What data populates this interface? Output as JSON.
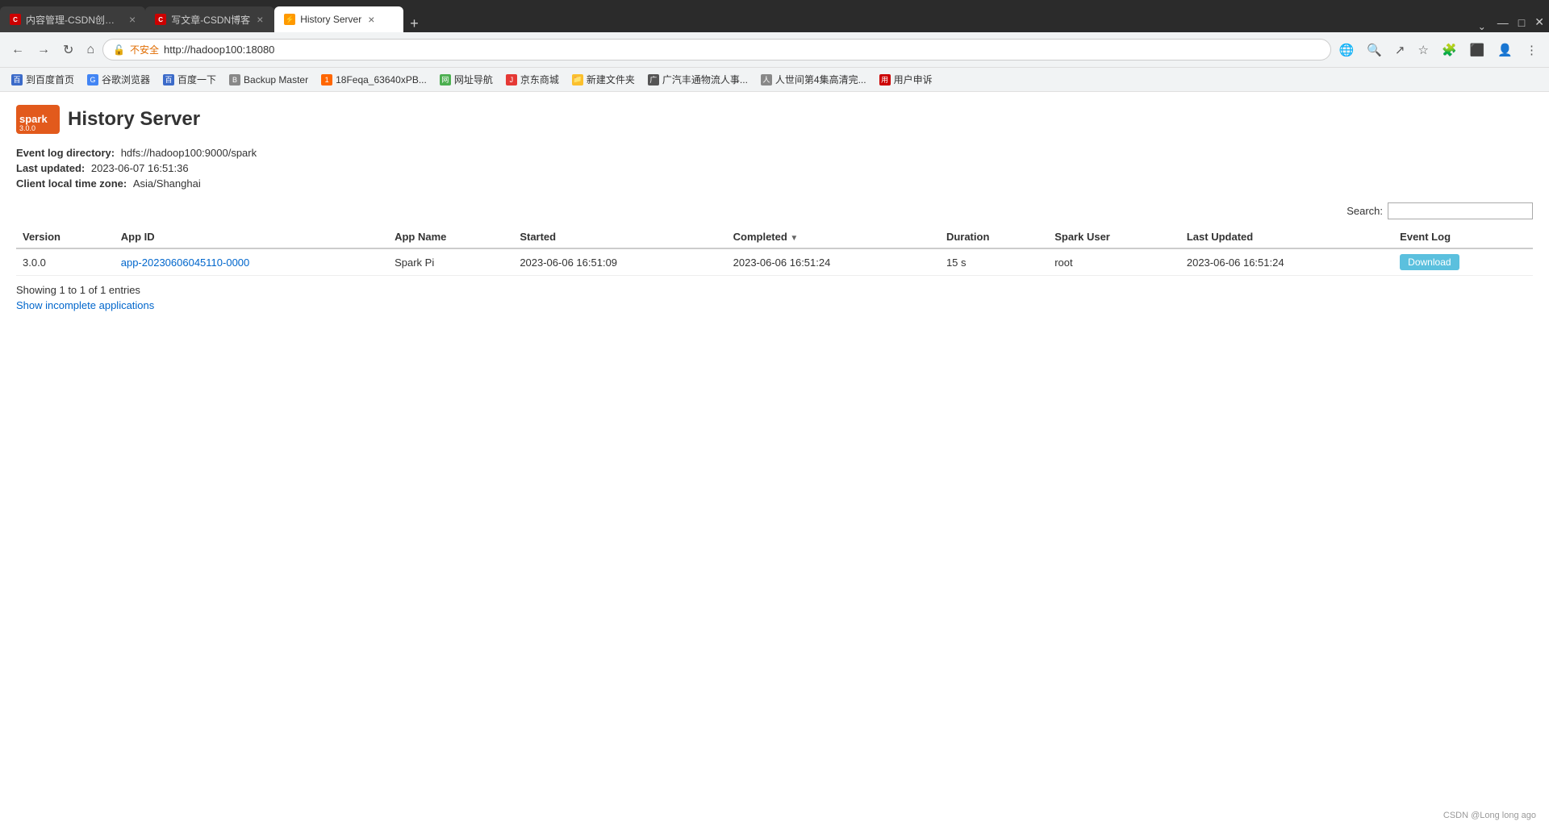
{
  "browser": {
    "tabs": [
      {
        "id": "tab1",
        "favicon_color": "#c00",
        "favicon_text": "C",
        "label": "内容管理-CSDN创作中心",
        "active": false
      },
      {
        "id": "tab2",
        "favicon_color": "#c00",
        "favicon_text": "C",
        "label": "写文章-CSDN博客",
        "active": false
      },
      {
        "id": "tab3",
        "favicon_color": "#f60",
        "favicon_text": "S",
        "label": "History Server",
        "active": true
      }
    ],
    "url": "http://hadoop100:18080",
    "url_security_label": "不安全",
    "bookmarks": [
      {
        "label": "到百度首页",
        "color": "#3c6bc9"
      },
      {
        "label": "谷歌浏览器",
        "color": "#4285f4"
      },
      {
        "label": "百度一下",
        "color": "#3c6bc9"
      },
      {
        "label": "Backup Master",
        "color": "#888"
      },
      {
        "label": "18Feqa_63640xPB...",
        "color": "#f60"
      },
      {
        "label": "网址导航",
        "color": "#4caf50"
      },
      {
        "label": "京东商城",
        "color": "#e53935"
      },
      {
        "label": "新建文件夹",
        "color": "#fbc02d"
      },
      {
        "label": "广汽丰通物流人事...",
        "color": "#555"
      },
      {
        "label": "人世间第4集高清完...",
        "color": "#888"
      },
      {
        "label": "用户申诉",
        "color": "#c00"
      }
    ]
  },
  "page": {
    "title": "History Server",
    "spark_version": "3.0.0",
    "info": {
      "event_log_label": "Event log directory:",
      "event_log_value": "hdfs://hadoop100:9000/spark",
      "last_updated_label": "Last updated:",
      "last_updated_value": "2023-06-07 16:51:36",
      "timezone_label": "Client local time zone:",
      "timezone_value": "Asia/Shanghai"
    },
    "search": {
      "label": "Search:",
      "placeholder": ""
    },
    "table": {
      "columns": [
        {
          "key": "version",
          "label": "Version"
        },
        {
          "key": "app_id",
          "label": "App ID"
        },
        {
          "key": "app_name",
          "label": "App Name"
        },
        {
          "key": "started",
          "label": "Started"
        },
        {
          "key": "completed",
          "label": "Completed",
          "has_sort": true
        },
        {
          "key": "duration",
          "label": "Duration"
        },
        {
          "key": "spark_user",
          "label": "Spark User"
        },
        {
          "key": "last_updated",
          "label": "Last Updated"
        },
        {
          "key": "event_log",
          "label": "Event Log"
        }
      ],
      "rows": [
        {
          "version": "3.0.0",
          "app_id": "app-20230606045110-0000",
          "app_id_href": "http://hadoop100:18080/history/app-20230606045110-0000",
          "app_name": "Spark Pi",
          "started": "2023-06-06 16:51:09",
          "completed": "2023-06-06 16:51:24",
          "duration": "15 s",
          "spark_user": "root",
          "last_updated": "2023-06-06 16:51:24",
          "event_log_btn": "Download"
        }
      ]
    },
    "footer": {
      "entries_text": "Showing 1 to 1 of 1 entries",
      "show_incomplete_label": "Show incomplete applications"
    }
  },
  "watermark": "CSDN @Long long ago"
}
